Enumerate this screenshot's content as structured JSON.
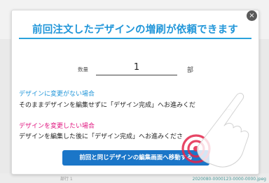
{
  "modal": {
    "title": "前回注文したデザインの増刷が依頼できます",
    "close_glyph": "×",
    "quantity": {
      "label": "数量",
      "value": "1",
      "unit": "部"
    },
    "section_unchanged": {
      "heading": "デザインに変更がない場合",
      "body": "そのままデザインを編集せずに「デザイン完成」へお進みくだ"
    },
    "section_changed": {
      "heading": "デザインを変更したい場合",
      "body": "デザインを編集した後に「デザイン完成」へお進みくださ"
    },
    "cta_label": "前回と同じデザインの編集画面へ移動する"
  },
  "background": {
    "footer_left": "部行 1",
    "footer_right": "2020080-0000123-0000-0000.jpeg"
  },
  "colors": {
    "accent_blue": "#2196d9",
    "button_blue": "#1b76c8",
    "pink": "#e0157f",
    "click_ring": "#e3254a"
  },
  "icons": {
    "close": "close-icon",
    "pointer": "pointing-hand-icon",
    "click": "click-ring-icon"
  }
}
